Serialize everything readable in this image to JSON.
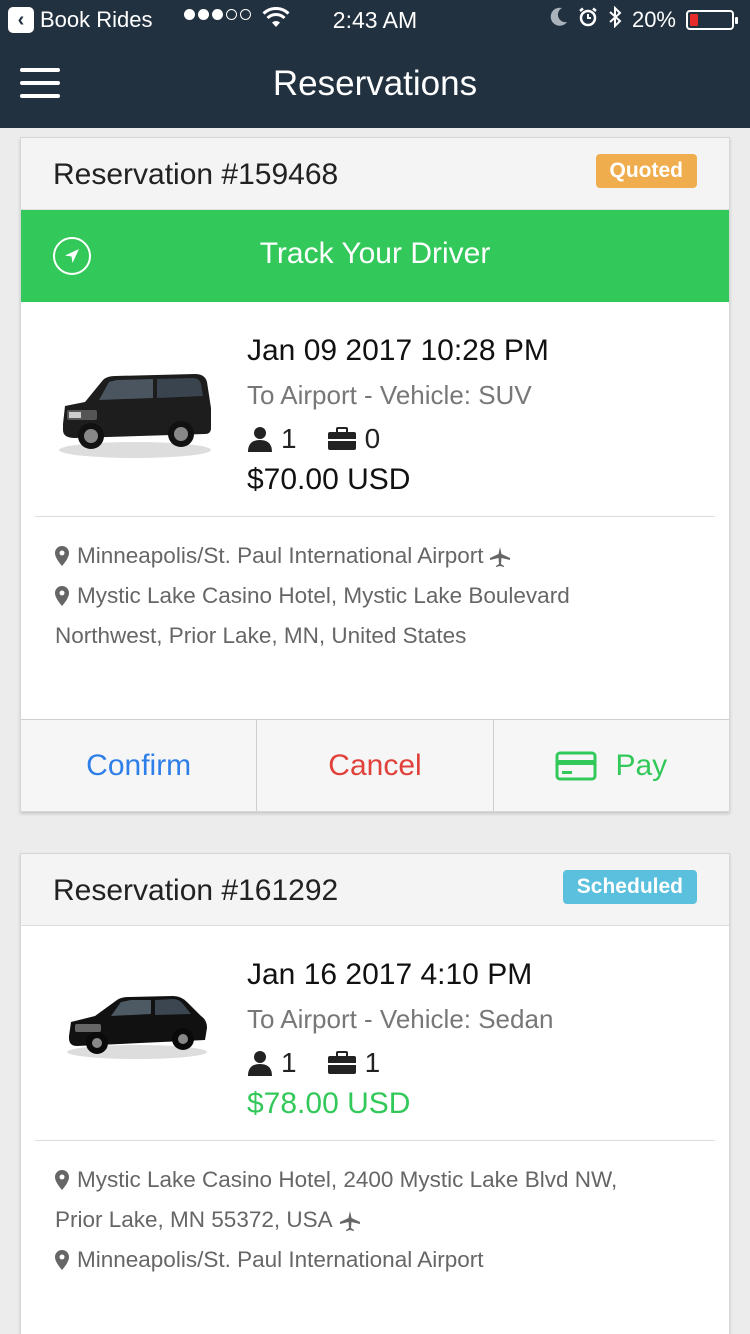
{
  "status_bar": {
    "app_back_label": "Book Rides",
    "time": "2:43 AM",
    "battery_text": "20%"
  },
  "header": {
    "title": "Reservations"
  },
  "reservations": [
    {
      "title": "Reservation #159468",
      "status": "Quoted",
      "status_color": "#f0ad4e",
      "track_label": "Track Your Driver",
      "datetime": "Jan 09 2017 10:28 PM",
      "subline": "To Airport - Vehicle: SUV",
      "passengers": "1",
      "bags": "0",
      "price": "$70.00 USD",
      "pickup": "Minneapolis/St. Paul International Airport",
      "dropoff_line1": "Mystic Lake Casino Hotel, Mystic Lake Boulevard",
      "dropoff_line2": "Northwest, Prior Lake, MN, United States",
      "actions": {
        "confirm": "Confirm",
        "cancel": "Cancel",
        "pay": "Pay"
      }
    },
    {
      "title": "Reservation #161292",
      "status": "Scheduled",
      "status_color": "#5bc0de",
      "datetime": "Jan 16 2017 4:10 PM",
      "subline": "To Airport - Vehicle: Sedan",
      "passengers": "1",
      "bags": "1",
      "price": "$78.00 USD",
      "pickup_line1": "Mystic Lake Casino Hotel, 2400 Mystic Lake Blvd NW,",
      "pickup_line2": "Prior Lake, MN 55372, USA",
      "dropoff": "Minneapolis/St. Paul International Airport"
    }
  ],
  "colors": {
    "nav_bg": "#223140",
    "track_green": "#33c95a",
    "confirm_blue": "#2f7fe9",
    "cancel_red": "#e0413a"
  }
}
